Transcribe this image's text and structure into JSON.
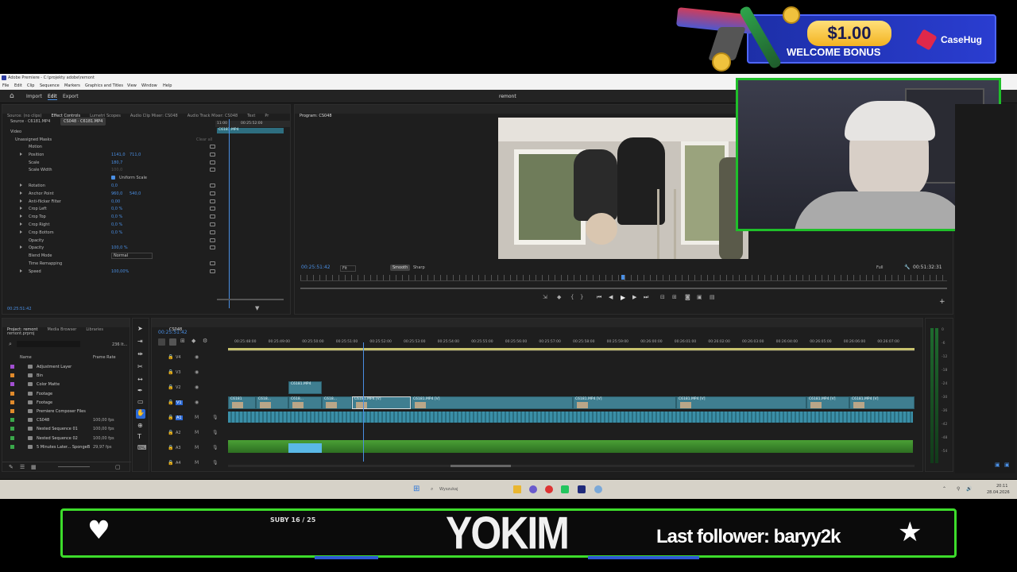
{
  "ad": {
    "amount": "$1.00",
    "text": "WELCOME BONUS",
    "brand": "CaseHug"
  },
  "window": {
    "title": "Adobe Premiere - C:\\projekty adobe\\remont",
    "menu": [
      "File",
      "Edit",
      "Clip",
      "Sequence",
      "Markers",
      "Graphics and Titles",
      "View",
      "Window",
      "Help"
    ]
  },
  "workspace": {
    "home": "⌂",
    "tabs": [
      "Import",
      "Edit",
      "Export"
    ],
    "project_name": "remont"
  },
  "source_panel": {
    "tabs": [
      "Source: (no clips)",
      "Effect Controls",
      "Lumetri Scopes",
      "Audio Clip Mixer: CS048",
      "Audio Track Mixer: CS048",
      "Text",
      "Pr"
    ],
    "source_clip": "Source · C6181.MP4",
    "seq_clip": "CS048 · C6181.MP4",
    "mini_timecodes": [
      "11:00",
      "00:25:52:00"
    ],
    "mini_clip": "C6181.MP4",
    "video_header": "Video",
    "masks": "Unassigned Masks",
    "clear": "Clear all",
    "rows": [
      {
        "label": "Motion",
        "v1": "",
        "v2": ""
      },
      {
        "label": "Position",
        "v1": "1141,0",
        "v2": "711,0"
      },
      {
        "label": "Scale",
        "v1": "180,7",
        "v2": ""
      },
      {
        "label": "Scale Width",
        "v1": "100,0",
        "v2": ""
      },
      {
        "label": "Uniform Scale",
        "v1": "",
        "v2": ""
      },
      {
        "label": "Rotation",
        "v1": "0,0",
        "v2": ""
      },
      {
        "label": "Anchor Point",
        "v1": "960,0",
        "v2": "540,0"
      },
      {
        "label": "Anti-flicker Filter",
        "v1": "0,00",
        "v2": ""
      },
      {
        "label": "Crop Left",
        "v1": "0,0 %",
        "v2": ""
      },
      {
        "label": "Crop Top",
        "v1": "0,0 %",
        "v2": ""
      },
      {
        "label": "Crop Right",
        "v1": "0,0 %",
        "v2": ""
      },
      {
        "label": "Crop Bottom",
        "v1": "0,0 %",
        "v2": ""
      },
      {
        "label": "Opacity",
        "v1": "",
        "v2": ""
      },
      {
        "label": "Opacity",
        "v1": "100,0 %",
        "v2": ""
      },
      {
        "label": "Blend Mode",
        "v1": "Normal",
        "v2": ""
      },
      {
        "label": "Time Remapping",
        "v1": "",
        "v2": ""
      },
      {
        "label": "Speed",
        "v1": "100,00%",
        "v2": ""
      }
    ],
    "timecode": "00:25:51:42"
  },
  "program": {
    "title": "Program: CS048",
    "timecode": "00:25:51:42",
    "fit": "Fit",
    "smooth": "Smooth",
    "sharp": "Sharp",
    "full": "Full",
    "duration": "00:51:32:31"
  },
  "project": {
    "tabs": [
      "Project: remont",
      "Media Browser",
      "Libraries"
    ],
    "file": "remont.prproj",
    "count": "236 It...",
    "col_name": "Name",
    "col_rate": "Frame Rate",
    "items": [
      {
        "name": "Adjustment Layer",
        "rate": "",
        "color": "#a24fd1"
      },
      {
        "name": "Bin",
        "rate": "",
        "color": "#e08a2b"
      },
      {
        "name": "Color Matte",
        "rate": "",
        "color": "#a24fd1"
      },
      {
        "name": "Footage",
        "rate": "",
        "color": "#e08a2b"
      },
      {
        "name": "Footage",
        "rate": "",
        "color": "#e08a2b"
      },
      {
        "name": "Premiere Composer Files",
        "rate": "",
        "color": "#e08a2b"
      },
      {
        "name": "CS048",
        "rate": "100,00 fps",
        "color": "#3aa84a"
      },
      {
        "name": "Nested Sequence 01",
        "rate": "100,00 fps",
        "color": "#3aa84a"
      },
      {
        "name": "Nested Sequence 02",
        "rate": "100,00 fps",
        "color": "#3aa84a"
      },
      {
        "name": "5 Minutes Later... SpongeB",
        "rate": "29,97 fps",
        "color": "#3aa84a"
      }
    ]
  },
  "timeline": {
    "tab": "CS048",
    "timecode": "00:25:51:42",
    "ruler": [
      "00:25:48:00",
      "00:25:49:00",
      "00:25:50:00",
      "00:25:51:00",
      "00:25:52:00",
      "00:25:53:00",
      "00:25:54:00",
      "00:25:55:00",
      "00:25:56:00",
      "00:25:57:00",
      "00:25:58:00",
      "00:25:59:00",
      "00:26:00:00",
      "00:26:01:00",
      "00:26:02:00",
      "00:26:03:00",
      "00:26:04:00",
      "00:26:05:00",
      "00:26:06:00",
      "00:26:07:00"
    ],
    "tracks": [
      "V4",
      "V3",
      "V2",
      "V1",
      "A1",
      "A2",
      "A3",
      "A4"
    ],
    "v2_clip": "C6181.MP4",
    "v1_clips": [
      "C6181",
      "C618...",
      "C618...",
      "C618...",
      "C6181.MP4 [V]",
      "C6181.MP4 [V]",
      "C6181.MP4 [V]",
      "C6181.MP4 [V]",
      "C6181.MP4 [V]",
      "C6181.MP4 [V]"
    ],
    "meter": [
      "0",
      "-6",
      "-12",
      "-18",
      "-24",
      "-30",
      "-36",
      "-42",
      "-48",
      "-54"
    ]
  },
  "taskbar": {
    "search": "Wyszukaj",
    "time": "20:11",
    "date": "28.04.2026"
  },
  "stream": {
    "subs": "SUBY 16 / 25",
    "name": "YOKIM",
    "follower": "Last follower: baryy2k"
  }
}
